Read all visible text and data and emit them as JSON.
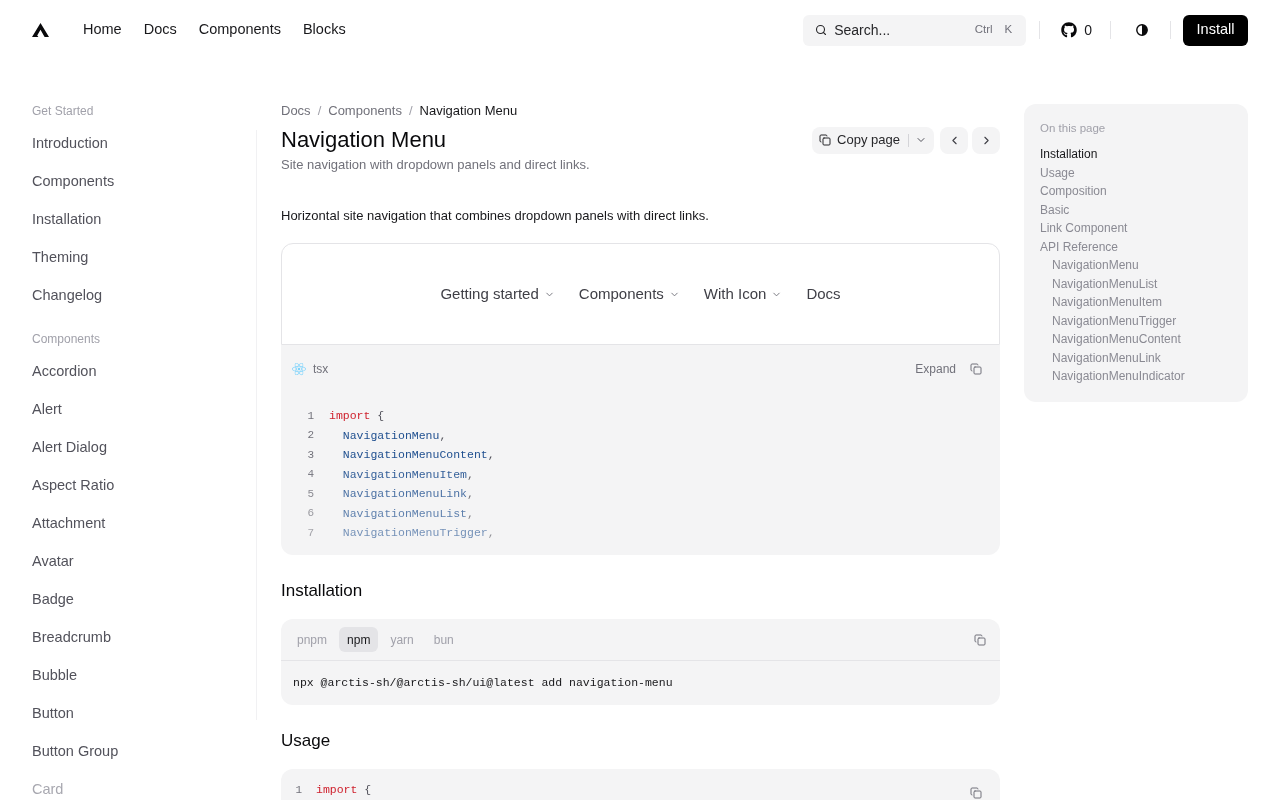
{
  "header": {
    "nav": [
      {
        "label": "Home"
      },
      {
        "label": "Docs"
      },
      {
        "label": "Components"
      },
      {
        "label": "Blocks"
      }
    ],
    "search": {
      "placeholder": "Search...",
      "shortcut": [
        "Ctrl",
        "K"
      ]
    },
    "github_count": "0",
    "install": "Install"
  },
  "sidebar": {
    "sections": [
      {
        "title": "Get Started",
        "items": [
          "Introduction",
          "Components",
          "Installation",
          "Theming",
          "Changelog"
        ]
      },
      {
        "title": "Components",
        "items": [
          "Accordion",
          "Alert",
          "Alert Dialog",
          "Aspect Ratio",
          "Attachment",
          "Avatar",
          "Badge",
          "Breadcrumb",
          "Bubble",
          "Button",
          "Button Group",
          "Card"
        ]
      }
    ]
  },
  "main": {
    "breadcrumb": {
      "items": [
        "Docs",
        "Components",
        "Navigation Menu"
      ],
      "separator": "/"
    },
    "title": "Navigation Menu",
    "description": "Site navigation with dropdown panels and direct links.",
    "copy_page": "Copy page",
    "intro": "Horizontal site navigation that combines dropdown panels with direct links.",
    "preview": {
      "nav": [
        {
          "label": "Getting started",
          "dropdown": true
        },
        {
          "label": "Components",
          "dropdown": true
        },
        {
          "label": "With Icon",
          "dropdown": true
        },
        {
          "label": "Docs",
          "dropdown": false
        }
      ]
    },
    "code": {
      "language": "tsx",
      "expand": "Expand",
      "lines": [
        {
          "number": "1",
          "tokens": [
            {
              "kind": "keyword",
              "text": "import"
            },
            {
              "kind": "punct",
              "text": " {"
            }
          ]
        },
        {
          "number": "2",
          "tokens": [
            {
              "kind": "identifier",
              "text": "  NavigationMenu"
            },
            {
              "kind": "punct",
              "text": ","
            }
          ]
        },
        {
          "number": "3",
          "tokens": [
            {
              "kind": "identifier",
              "text": "  NavigationMenuContent"
            },
            {
              "kind": "punct",
              "text": ","
            }
          ]
        },
        {
          "number": "4",
          "tokens": [
            {
              "kind": "identifier",
              "text": "  NavigationMenuItem"
            },
            {
              "kind": "punct",
              "text": ","
            }
          ]
        },
        {
          "number": "5",
          "tokens": [
            {
              "kind": "identifier",
              "text": "  NavigationMenuLink"
            },
            {
              "kind": "punct",
              "text": ","
            }
          ]
        },
        {
          "number": "6",
          "tokens": [
            {
              "kind": "identifier",
              "text": "  NavigationMenuList"
            },
            {
              "kind": "punct",
              "text": ","
            }
          ]
        },
        {
          "number": "7",
          "tokens": [
            {
              "kind": "identifier",
              "text": "  NavigationMenuTrigger"
            },
            {
              "kind": "punct",
              "text": ","
            }
          ]
        }
      ]
    },
    "installation": {
      "heading": "Installation",
      "tabs": [
        {
          "label": "pnpm",
          "selected": false
        },
        {
          "label": "npm",
          "selected": true
        },
        {
          "label": "yarn",
          "selected": false
        },
        {
          "label": "bun",
          "selected": false
        }
      ],
      "command": "npx @arctis-sh/@arctis-sh/ui@latest add navigation-menu"
    },
    "usage": {
      "heading": "Usage",
      "lines": [
        {
          "number": "1",
          "tokens": [
            {
              "kind": "keyword",
              "text": "import"
            },
            {
              "kind": "punct",
              "text": " {"
            }
          ]
        }
      ]
    }
  },
  "toc": {
    "title": "On this page",
    "items": [
      {
        "label": "Installation",
        "selected": true
      },
      {
        "label": "Usage",
        "selected": false
      },
      {
        "label": "Composition",
        "selected": false
      },
      {
        "label": "Basic",
        "selected": false
      },
      {
        "label": "Link Component",
        "selected": false
      },
      {
        "label": "API Reference",
        "selected": false,
        "children": [
          {
            "label": "NavigationMenu",
            "selected": false
          },
          {
            "label": "NavigationMenuList",
            "selected": false
          },
          {
            "label": "NavigationMenuItem",
            "selected": false
          },
          {
            "label": "NavigationMenuTrigger",
            "selected": false
          },
          {
            "label": "NavigationMenuContent",
            "selected": false
          },
          {
            "label": "NavigationMenuLink",
            "selected": false
          },
          {
            "label": "NavigationMenuIndicator",
            "selected": false
          }
        ]
      }
    ]
  }
}
